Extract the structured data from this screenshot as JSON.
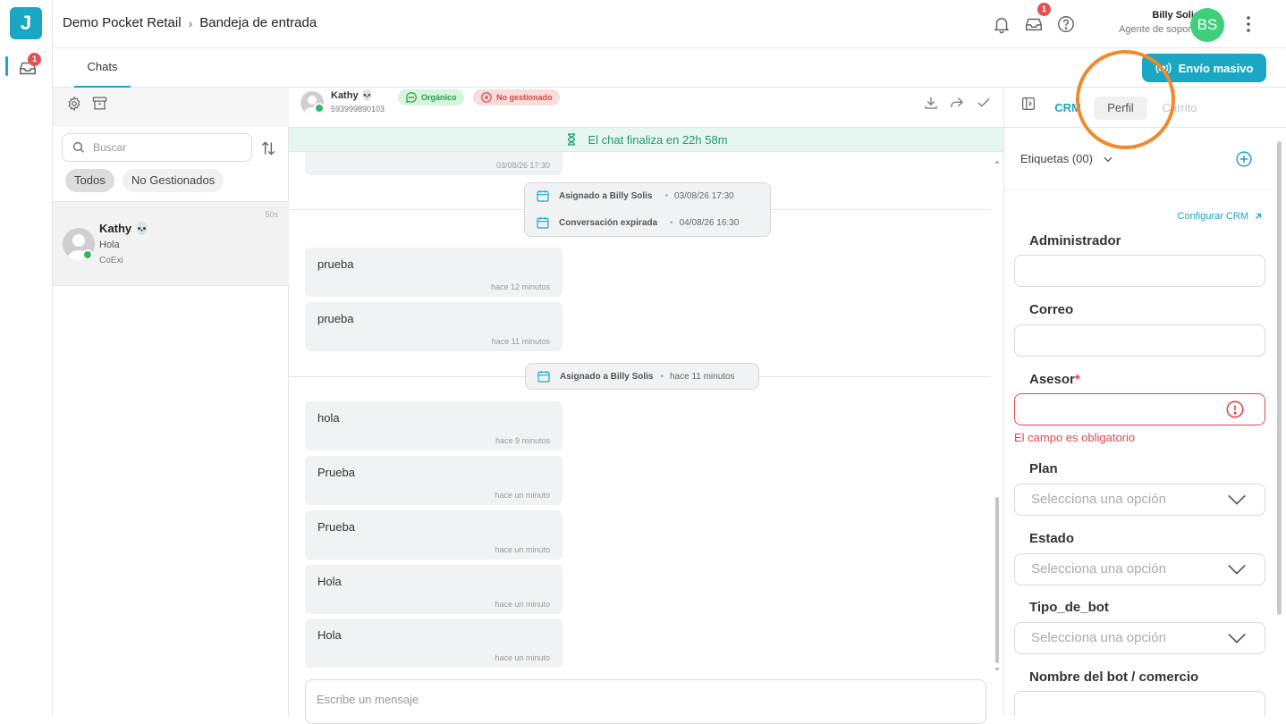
{
  "app": {
    "logo_letter": "J",
    "brand_color": "#1aa7c4"
  },
  "rail": {
    "inbox_badge": "1"
  },
  "header": {
    "workspace": "Demo Pocket Retail",
    "page": "Bandeja de entrada",
    "inbox_badge": "1",
    "user_name": "Billy Solis",
    "user_role": "Agente de soporte",
    "avatar_initials": "BS"
  },
  "tabs": {
    "chats": "Chats",
    "mass_send": "Envío masivo"
  },
  "list": {
    "search_placeholder": "Buscar",
    "filters": [
      "Todos",
      "No Gestionados"
    ],
    "items": [
      {
        "name": "Kathy 💀",
        "preview": "Hola",
        "source": "CoExi",
        "time": "50s"
      }
    ]
  },
  "chat": {
    "contact_name": "Kathy 💀",
    "contact_phone": "593999890103",
    "tag_organic": "Orgánico",
    "tag_unmanaged": "No gestionado",
    "timer_text": "El chat finaliza en 22h 58m",
    "top_partial_time": "03/08/26 17:30",
    "events1": [
      {
        "label": "Asignado a Billy Solis",
        "date": "03/08/26 17:30"
      },
      {
        "label": "Conversación expirada",
        "date": "04/08/26 16:30"
      }
    ],
    "messages1": [
      {
        "text": "prueba",
        "time": "hace 12 minutos"
      },
      {
        "text": "prueba",
        "time": "hace 11 minutos"
      }
    ],
    "event2": {
      "label": "Asignado a Billy Solis",
      "date": "hace 11 minutos"
    },
    "messages2": [
      {
        "text": "hola",
        "time": "hace 9 minutos"
      },
      {
        "text": "Prueba",
        "time": "hace un minuto"
      },
      {
        "text": "Prueba",
        "time": "hace un minuto"
      },
      {
        "text": "Hola",
        "time": "hace un minuto"
      },
      {
        "text": "Hola",
        "time": "hace un minuto"
      }
    ],
    "composer_placeholder": "Escribe un mensaje"
  },
  "panel": {
    "tabs": [
      "CRM",
      "Perfil",
      "Carrito"
    ],
    "tags_label": "Etiquetas (00)",
    "configure_link": "Configurar CRM",
    "fields": {
      "admin": "Administrador",
      "email": "Correo",
      "advisor": "Asesor",
      "required_mark": "*",
      "advisor_error": "El campo es obligatorio",
      "plan": "Plan",
      "state": "Estado",
      "bot_type": "Tipo_de_bot",
      "bot_name": "Nombre del bot / comercio",
      "select_placeholder": "Selecciona una opción"
    }
  }
}
